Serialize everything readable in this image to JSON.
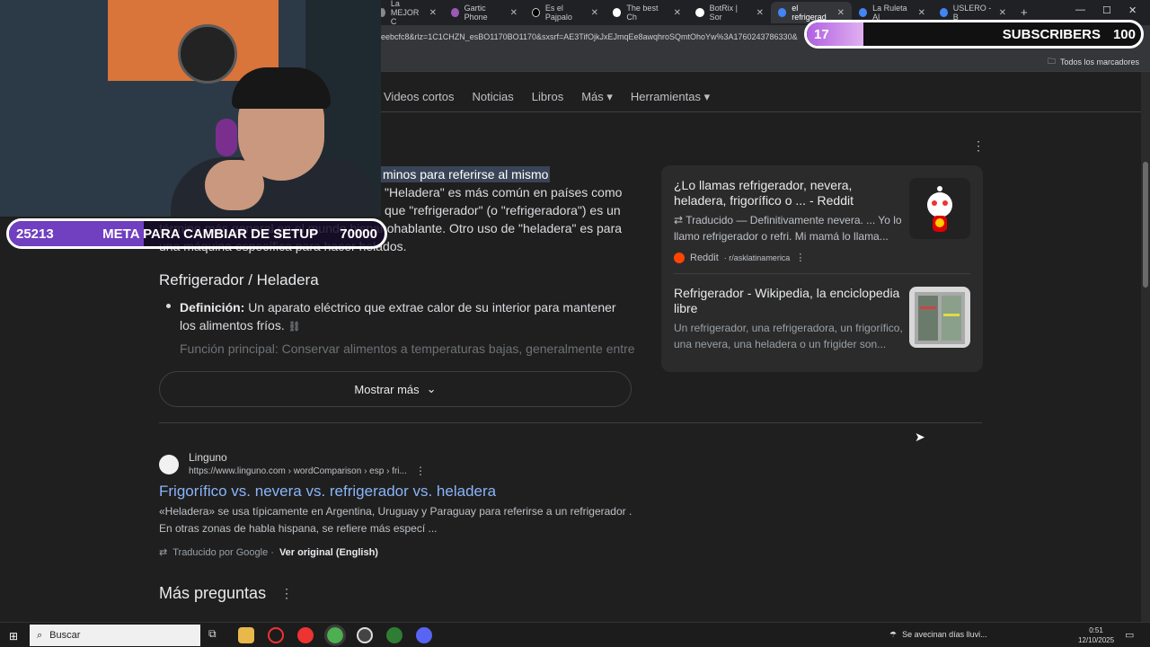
{
  "browser": {
    "tabs": [
      {
        "label": "La MEJOR C"
      },
      {
        "label": "Gartic Phone"
      },
      {
        "label": "Es el Pajpalo"
      },
      {
        "label": "The best Ch"
      },
      {
        "label": "BotRix | Sor"
      },
      {
        "label": "el refrigerad"
      },
      {
        "label": "La Ruleta Al"
      },
      {
        "label": "USLERO - B"
      }
    ],
    "url": "eebcfc8&rlz=1C1CHZN_esBO1170BO1170&sxsrf=AE3TifOjkJxEJmqEe8awqhroSQmtOhoYw%3A1760243786330&",
    "bookmarks_all": "Todos los marcadores"
  },
  "nav_tabs": [
    "Videos cortos",
    "Noticias",
    "Libros",
    "Más",
    "Herramientas"
  ],
  "answer": {
    "highlight": "minos para referirse al mismo",
    "p1": "\"Heladera\" es más común en países como que \"refrigerador\" (o \"refrigeradora\") es un",
    "p2": "término más general en el mundo hispanohablante. Otro uso de \"heladera\" es para una máquina específica para hacer helados.",
    "heading": "Refrigerador / Heladera",
    "def_label": "Definición:",
    "def_text": "Un aparato eléctrico que extrae calor de su interior para mantener los alimentos fríos.",
    "func_faded": "Función principal: Conservar alimentos a temperaturas bajas, generalmente entre",
    "show_more": "Mostrar más"
  },
  "side_cards": [
    {
      "title": "¿Lo llamas refrigerador, nevera, heladera, frigorífico o ... - Reddit",
      "snippet": "Traducido — Definitivamente nevera. ... Yo lo llamo refrigerador o refri. Mi mamá lo llama...",
      "source": "Reddit",
      "source_path": "· r/asklatinamerica"
    },
    {
      "title": "Refrigerador - Wikipedia, la enciclopedia libre",
      "snippet": "Un refrigerador, una refrigeradora, un frigorífico, una nevera, una heladera o un frigider son..."
    }
  ],
  "result": {
    "site": "Linguno",
    "url": "https://www.linguno.com › wordComparison › esp › fri...",
    "title": "Frigorífico vs. nevera vs. refrigerador vs. heladera",
    "snippet": "«Heladera» se usa típicamente en Argentina, Uruguay y Paraguay para referirse a un refrigerador . En otras zonas de habla hispana, se refiere más especí ...",
    "translated": "Traducido por Google ·",
    "original": "Ver original (English)"
  },
  "more_questions": "Más preguntas",
  "overlays": {
    "meta": {
      "start": "25213",
      "label": "META PARA CAMBIAR DE SETUP",
      "end": "70000",
      "progress": 0.36
    },
    "subs": {
      "start": "17",
      "label": "SUBSCRIBERS",
      "end": "100",
      "progress": 0.17
    }
  },
  "taskbar": {
    "search": "Buscar",
    "weather": "Se avecinan días lluvi...",
    "time": "0:51",
    "date": "12/10/2025"
  },
  "colors": {
    "accent_link": "#8ab4f8",
    "meta_fill": "#7040c0",
    "sub_fill": "#b060e0"
  }
}
